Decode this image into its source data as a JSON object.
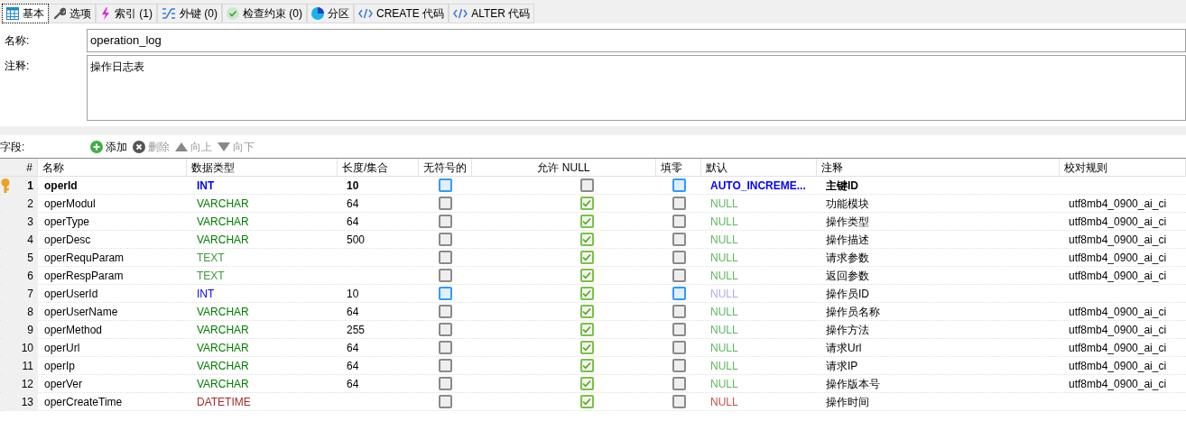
{
  "tabs": [
    {
      "label": "基本",
      "kind": "grid",
      "selected": true
    },
    {
      "label": "选项",
      "kind": "wrench",
      "selected": false
    },
    {
      "label": "索引 (1)",
      "kind": "bolt",
      "selected": false
    },
    {
      "label": "外键 (0)",
      "kind": "link",
      "selected": false
    },
    {
      "label": "检查约束 (0)",
      "kind": "check",
      "selected": false
    },
    {
      "label": "分区",
      "kind": "pie",
      "selected": false
    },
    {
      "label": "CREATE 代码",
      "kind": "code",
      "selected": false
    },
    {
      "label": "ALTER 代码",
      "kind": "code",
      "selected": false
    }
  ],
  "name_field": {
    "label": "名称:",
    "value": "operation_log"
  },
  "comment_field": {
    "label": "注释:",
    "value": "操作日志表"
  },
  "toolbar": {
    "label": "字段:",
    "buttons": [
      {
        "label": "添加",
        "kind": "plus",
        "disabled": false
      },
      {
        "label": "删除",
        "kind": "x",
        "disabled": true
      },
      {
        "label": "向上",
        "kind": "up",
        "disabled": true
      },
      {
        "label": "向下",
        "kind": "down",
        "disabled": true
      }
    ]
  },
  "table": {
    "columns": [
      "#",
      "名称",
      "数据类型",
      "长度/集合",
      "无符号的",
      "允许 NULL",
      "填零",
      "默认",
      "注释",
      "校对规则"
    ],
    "rows": [
      {
        "num": "1",
        "name": "operId",
        "type": {
          "text": "INT",
          "kind": "numeric"
        },
        "length": "10",
        "unsigned": false,
        "unsigned_enabled": true,
        "allow_null": false,
        "zerofill": false,
        "default": {
          "text": "AUTO_INCREME...",
          "kind": "auto"
        },
        "comment": "主键ID",
        "primary_key": true
      },
      {
        "num": "2",
        "name": "operModul",
        "type": {
          "text": "VARCHAR",
          "kind": "string"
        },
        "length": "64",
        "unsigned": false,
        "unsigned_enabled": false,
        "allow_null": true,
        "zerofill": false,
        "default": {
          "text": "NULL",
          "kind": "null"
        },
        "comment": "功能模块",
        "collation": "utf8mb4_0900_ai_ci",
        "primary_key": false
      },
      {
        "num": "3",
        "name": "operType",
        "type": {
          "text": "VARCHAR",
          "kind": "string"
        },
        "length": "64",
        "unsigned": false,
        "unsigned_enabled": false,
        "allow_null": true,
        "zerofill": false,
        "default": {
          "text": "NULL",
          "kind": "null"
        },
        "comment": "操作类型",
        "collation": "utf8mb4_0900_ai_ci",
        "primary_key": false
      },
      {
        "num": "4",
        "name": "operDesc",
        "type": {
          "text": "VARCHAR",
          "kind": "string"
        },
        "length": "500",
        "unsigned": false,
        "unsigned_enabled": false,
        "allow_null": true,
        "zerofill": false,
        "default": {
          "text": "NULL",
          "kind": "null"
        },
        "comment": "操作描述",
        "collation": "utf8mb4_0900_ai_ci",
        "primary_key": false
      },
      {
        "num": "5",
        "name": "operRequParam",
        "type": {
          "text": "TEXT",
          "kind": "text"
        },
        "unsigned": false,
        "unsigned_enabled": false,
        "allow_null": true,
        "zerofill": false,
        "default": {
          "text": "NULL",
          "kind": "null"
        },
        "comment": "请求参数",
        "collation": "utf8mb4_0900_ai_ci",
        "primary_key": false
      },
      {
        "num": "6",
        "name": "operRespParam",
        "type": {
          "text": "TEXT",
          "kind": "text"
        },
        "unsigned": false,
        "unsigned_enabled": false,
        "allow_null": true,
        "zerofill": false,
        "default": {
          "text": "NULL",
          "kind": "null"
        },
        "comment": "返回参数",
        "collation": "utf8mb4_0900_ai_ci",
        "primary_key": false
      },
      {
        "num": "7",
        "name": "operUserId",
        "type": {
          "text": "INT",
          "kind": "numeric"
        },
        "length": "10",
        "unsigned": false,
        "unsigned_enabled": true,
        "allow_null": true,
        "zerofill": false,
        "default": {
          "text": "NULL",
          "kind": "null_numeric"
        },
        "comment": "操作员ID",
        "primary_key": false
      },
      {
        "num": "8",
        "name": "operUserName",
        "type": {
          "text": "VARCHAR",
          "kind": "string"
        },
        "length": "64",
        "unsigned": false,
        "unsigned_enabled": false,
        "allow_null": true,
        "zerofill": false,
        "default": {
          "text": "NULL",
          "kind": "null"
        },
        "comment": "操作员名称",
        "collation": "utf8mb4_0900_ai_ci",
        "primary_key": false
      },
      {
        "num": "9",
        "name": "operMethod",
        "type": {
          "text": "VARCHAR",
          "kind": "string"
        },
        "length": "255",
        "unsigned": false,
        "unsigned_enabled": false,
        "allow_null": true,
        "zerofill": false,
        "default": {
          "text": "NULL",
          "kind": "null"
        },
        "comment": "操作方法",
        "collation": "utf8mb4_0900_ai_ci",
        "primary_key": false
      },
      {
        "num": "10",
        "name": "operUrl",
        "type": {
          "text": "VARCHAR",
          "kind": "string"
        },
        "length": "64",
        "unsigned": false,
        "unsigned_enabled": false,
        "allow_null": true,
        "zerofill": false,
        "default": {
          "text": "NULL",
          "kind": "null"
        },
        "comment": "请求Url",
        "collation": "utf8mb4_0900_ai_ci",
        "primary_key": false
      },
      {
        "num": "11",
        "name": "operIp",
        "type": {
          "text": "VARCHAR",
          "kind": "string"
        },
        "length": "64",
        "unsigned": false,
        "unsigned_enabled": false,
        "allow_null": true,
        "zerofill": false,
        "default": {
          "text": "NULL",
          "kind": "null"
        },
        "comment": "请求IP",
        "collation": "utf8mb4_0900_ai_ci",
        "primary_key": false
      },
      {
        "num": "12",
        "name": "operVer",
        "type": {
          "text": "VARCHAR",
          "kind": "string"
        },
        "length": "64",
        "unsigned": false,
        "unsigned_enabled": false,
        "allow_null": true,
        "zerofill": false,
        "default": {
          "text": "NULL",
          "kind": "null"
        },
        "comment": "操作版本号",
        "collation": "utf8mb4_0900_ai_ci",
        "primary_key": false
      },
      {
        "num": "13",
        "name": "operCreateTime",
        "type": {
          "text": "DATETIME",
          "kind": "temporal"
        },
        "unsigned": false,
        "unsigned_enabled": false,
        "allow_null": true,
        "zerofill": false,
        "default": {
          "text": "NULL",
          "kind": "null_temporal"
        },
        "comment": "操作时间",
        "primary_key": false
      }
    ]
  }
}
